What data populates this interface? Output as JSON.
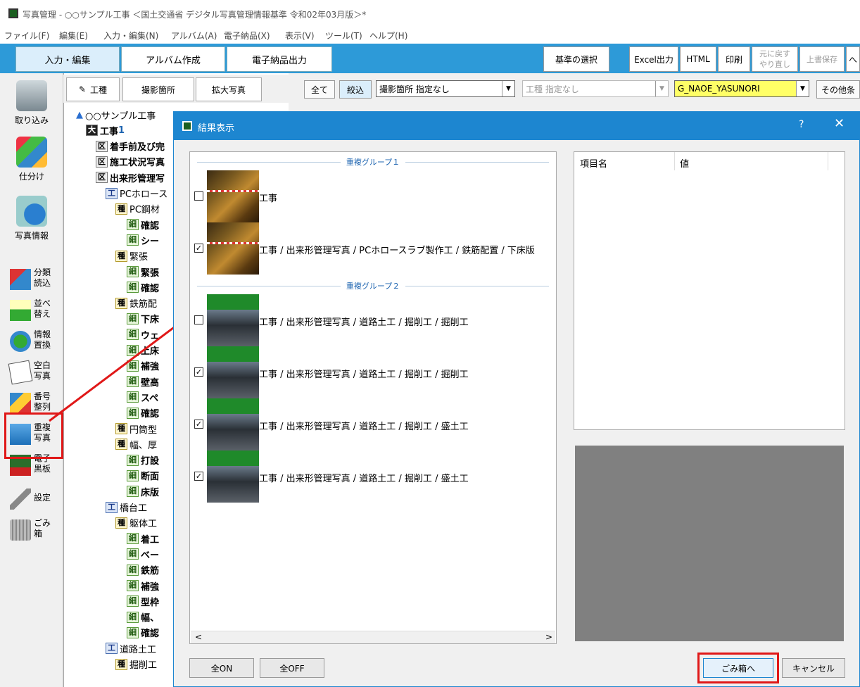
{
  "window": {
    "title": "写真管理 - ○○サンプル工事 ＜国土交通省 デジタル写真管理情報基準 令和02年03月版＞*"
  },
  "menu": [
    "ファイル(F)",
    "編集(E)",
    "入力・編集(N)",
    "アルバム(A)",
    "電子納品(X)",
    "表示(V)",
    "ツール(T)",
    "ヘルプ(H)"
  ],
  "toolbar": {
    "tabs": [
      "入力・編集",
      "アルバム作成",
      "電子納品出力"
    ],
    "standard_btn": "基準の選択",
    "excel_btn": "Excel出力",
    "html_btn": "HTML",
    "print_btn": "印刷",
    "undo_btn": "元に戻す",
    "redo_btn": "やり直し",
    "overwrite_btn": "上書保存",
    "more_btn": "へ"
  },
  "left_tools": {
    "import": "取り込み",
    "sort": "仕分け",
    "photo_info": "写真情報",
    "items": [
      {
        "name": "bunrui",
        "label": "分類読込"
      },
      {
        "name": "narabe",
        "label": "並べ替え"
      },
      {
        "name": "joho",
        "label": "情報置換"
      },
      {
        "name": "kuhaku",
        "label": "空白写真"
      },
      {
        "name": "bango",
        "label": "番号整列"
      },
      {
        "name": "choufuku",
        "label": "重複写真"
      },
      {
        "name": "denshi",
        "label": "電子黒板"
      },
      {
        "name": "settei",
        "label": "設定"
      },
      {
        "name": "gomi",
        "label": "ごみ箱"
      }
    ]
  },
  "tree_tabs": [
    "工種",
    "撮影箇所",
    "拡大写真"
  ],
  "tree": [
    {
      "badge": "",
      "text": "○○サンプル工事"
    },
    {
      "badge": "大",
      "text": "工事",
      "count": "1"
    },
    {
      "badge": "区",
      "text": "着手前及び完"
    },
    {
      "badge": "区",
      "text": "施工状況写真"
    },
    {
      "badge": "区",
      "text": "出来形管理写"
    },
    {
      "badge": "工",
      "text": "PCホロース"
    },
    {
      "badge": "種",
      "text": "PC鋼材"
    },
    {
      "badge": "細",
      "text": "確認"
    },
    {
      "badge": "細",
      "text": "シー"
    },
    {
      "badge": "種",
      "text": "緊張"
    },
    {
      "badge": "細",
      "text": "緊張"
    },
    {
      "badge": "細",
      "text": "確認"
    },
    {
      "badge": "種",
      "text": "鉄筋配"
    },
    {
      "badge": "細",
      "text": "下床"
    },
    {
      "badge": "細",
      "text": "ウェ"
    },
    {
      "badge": "細",
      "text": "上床"
    },
    {
      "badge": "細",
      "text": "補強"
    },
    {
      "badge": "細",
      "text": "壁高"
    },
    {
      "badge": "細",
      "text": "スペ"
    },
    {
      "badge": "細",
      "text": "確認"
    },
    {
      "badge": "種",
      "text": "円筒型"
    },
    {
      "badge": "種",
      "text": "幅、厚"
    },
    {
      "badge": "細",
      "text": "打設"
    },
    {
      "badge": "細",
      "text": "断面"
    },
    {
      "badge": "細",
      "text": "床版"
    },
    {
      "badge": "工",
      "text": "橋台工"
    },
    {
      "badge": "種",
      "text": "躯体工"
    },
    {
      "badge": "細",
      "text": "着工"
    },
    {
      "badge": "細",
      "text": "ベー"
    },
    {
      "badge": "細",
      "text": "鉄筋"
    },
    {
      "badge": "細",
      "text": "補強"
    },
    {
      "badge": "細",
      "text": "型枠"
    },
    {
      "badge": "細",
      "text": "幅、"
    },
    {
      "badge": "細",
      "text": "確認"
    },
    {
      "badge": "工",
      "text": "道路土工"
    },
    {
      "badge": "種",
      "text": "掘削工"
    }
  ],
  "filter": {
    "all_btn": "全て",
    "narrow_btn": "絞込",
    "location_select": "撮影箇所 指定なし",
    "koshu_select": "工種 指定なし",
    "user_select": "G_NAOE_YASUNORI",
    "other_btn": "その他条"
  },
  "dialog": {
    "title": "結果表示",
    "help": "?",
    "close": "✕",
    "groups": [
      {
        "label": "重複グループ１",
        "rows": [
          {
            "checked": false,
            "mark": "",
            "text": "工事"
          },
          {
            "checked": true,
            "mark": "✓",
            "text": "工事 / 出来形管理写真 / PCホロースラブ製作工 / 鉄筋配置 / 下床版"
          }
        ]
      },
      {
        "label": "重複グループ２",
        "rows": [
          {
            "checked": false,
            "mark": "",
            "text": "工事 / 出来形管理写真 / 道路土工 / 掘削工 / 掘削工"
          },
          {
            "checked": true,
            "mark": "✓",
            "text": "工事 / 出来形管理写真 / 道路土工 / 掘削工 / 掘削工"
          },
          {
            "checked": true,
            "mark": "✓",
            "text": "工事 / 出来形管理写真 / 道路土工 / 掘削工 / 盛土工"
          },
          {
            "checked": true,
            "mark": "✓",
            "text": "工事 / 出来形管理写真 / 道路土工 / 掘削工 / 盛土工"
          }
        ]
      }
    ],
    "prop_headers": [
      "項目名",
      "値"
    ],
    "scroll_left": "<",
    "scroll_right": ">",
    "all_on": "全ON",
    "all_off": "全OFF",
    "trash_btn": "ごみ箱へ",
    "cancel_btn": "キャンセル"
  }
}
